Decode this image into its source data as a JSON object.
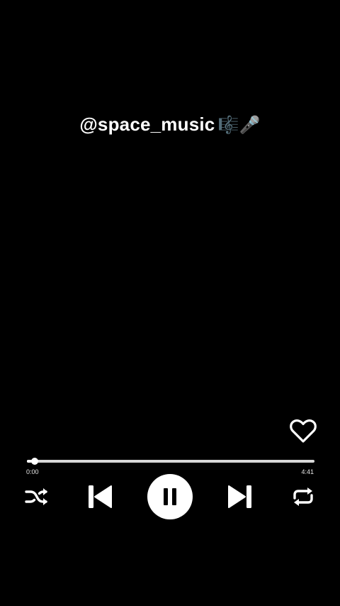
{
  "caption": {
    "handle": "@space_music",
    "emoji": "🎼🎤"
  },
  "player": {
    "progress_fraction": 0.015,
    "elapsed_label": "0:00",
    "total_label": "4:41",
    "liked": false,
    "state": "playing"
  },
  "icons": {
    "like": "heart-outline-icon",
    "shuffle": "shuffle-icon",
    "previous": "skip-previous-icon",
    "pause": "pause-icon",
    "next": "skip-next-icon",
    "repeat": "repeat-icon"
  },
  "colors": {
    "background": "#000000",
    "foreground": "#ffffff",
    "track": "#d8d8d8"
  }
}
